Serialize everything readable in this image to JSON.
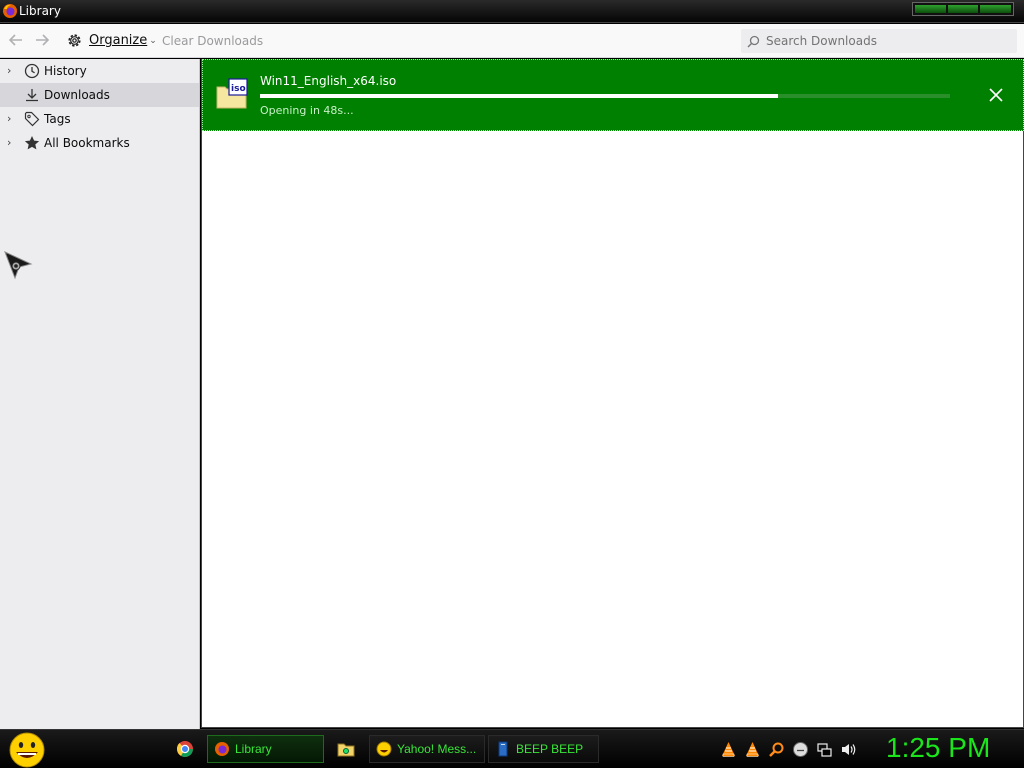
{
  "window": {
    "title": "Library"
  },
  "toolbar": {
    "organize_label": "Organize",
    "clear_label": "Clear Downloads",
    "search_placeholder": "Search Downloads"
  },
  "sidebar": {
    "items": [
      {
        "label": "History",
        "icon": "clock-icon"
      },
      {
        "label": "Downloads",
        "icon": "download-icon"
      },
      {
        "label": "Tags",
        "icon": "tag-icon"
      },
      {
        "label": "All Bookmarks",
        "icon": "star-icon"
      }
    ]
  },
  "download": {
    "filename": "Win11_English_x64.iso",
    "icon_label": "iso",
    "status": "Opening in 48s...",
    "progress": 0.75,
    "accent": "#008000"
  },
  "taskbar": {
    "tasks": [
      {
        "label": "Library"
      },
      {
        "label": "Yahoo! Mess..."
      },
      {
        "label": "BEEP BEEP"
      }
    ],
    "clock": "1:25 PM",
    "text_color": "#39e639"
  }
}
